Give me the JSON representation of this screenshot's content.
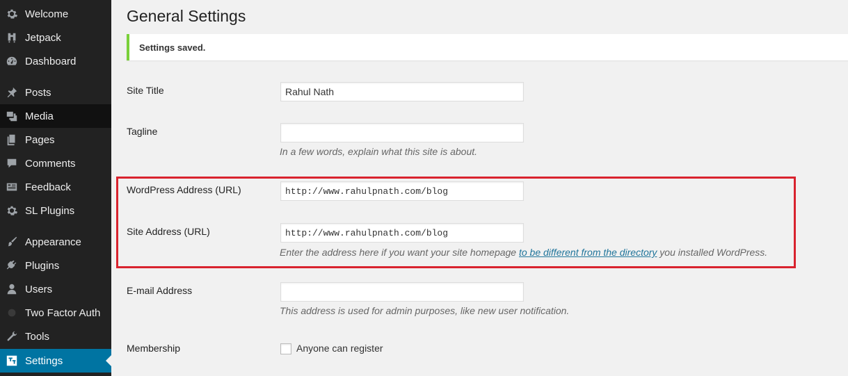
{
  "sidebar": {
    "items": [
      {
        "label": "Welcome",
        "icon": "gear-icon"
      },
      {
        "label": "Jetpack",
        "icon": "jetpack-icon"
      },
      {
        "label": "Dashboard",
        "icon": "dashboard-icon"
      },
      {
        "label": "Posts",
        "icon": "pushpin-icon"
      },
      {
        "label": "Media",
        "icon": "media-icon"
      },
      {
        "label": "Pages",
        "icon": "pages-icon"
      },
      {
        "label": "Comments",
        "icon": "comment-icon"
      },
      {
        "label": "Feedback",
        "icon": "feedback-icon"
      },
      {
        "label": "SL Plugins",
        "icon": "gear-icon"
      },
      {
        "label": "Appearance",
        "icon": "paintbrush-icon"
      },
      {
        "label": "Plugins",
        "icon": "plug-icon"
      },
      {
        "label": "Users",
        "icon": "user-icon"
      },
      {
        "label": "Two Factor Auth",
        "icon": "lock-icon"
      },
      {
        "label": "Tools",
        "icon": "wrench-icon"
      },
      {
        "label": "Settings",
        "icon": "settings-icon"
      }
    ],
    "active": "Settings",
    "hovered": "Media"
  },
  "page": {
    "title": "General Settings",
    "notice": "Settings saved."
  },
  "form": {
    "site_title": {
      "label": "Site Title",
      "value": "Rahul Nath"
    },
    "tagline": {
      "label": "Tagline",
      "value": "",
      "description": "In a few words, explain what this site is about."
    },
    "wp_address": {
      "label": "WordPress Address (URL)",
      "value": "http://www.rahulpnath.com/blog"
    },
    "site_address": {
      "label": "Site Address (URL)",
      "value": "http://www.rahulpnath.com/blog",
      "description_before": "Enter the address here if you want your site homepage ",
      "description_link": "to be different from the directory",
      "description_after": " you installed WordPress."
    },
    "email": {
      "label": "E-mail Address",
      "value": "",
      "description": "This address is used for admin purposes, like new user notification."
    },
    "membership": {
      "label": "Membership",
      "checkbox_label": "Anyone can register",
      "checked": false
    }
  },
  "colors": {
    "sidebar_bg": "#222222",
    "active_bg": "#0074a2",
    "notice_border": "#7ad03a",
    "highlight_border": "#d9232e",
    "link": "#21759b"
  }
}
